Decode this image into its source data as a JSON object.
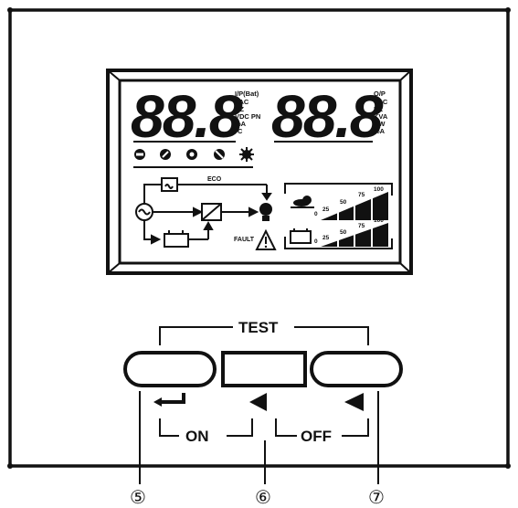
{
  "lcd": {
    "input_reading": "88.8",
    "input_units": [
      "I/P(Bat)",
      "VAC",
      "HZ",
      "VDC PN",
      "%A",
      "°C"
    ],
    "output_reading": "88.8",
    "output_units": [
      "O/P",
      "VAC",
      "HZ",
      "KVA",
      "KW",
      "%A"
    ],
    "eco_label": "ECO",
    "fault_label": "FAULT",
    "load_scale": [
      "0",
      "25",
      "50",
      "75",
      "100"
    ],
    "battery_scale": [
      "0",
      "25",
      "50",
      "75",
      "100"
    ]
  },
  "controls": {
    "test_label": "TEST",
    "on_label": "ON",
    "off_label": "OFF",
    "callouts": [
      "⑤",
      "⑥",
      "⑦"
    ]
  }
}
